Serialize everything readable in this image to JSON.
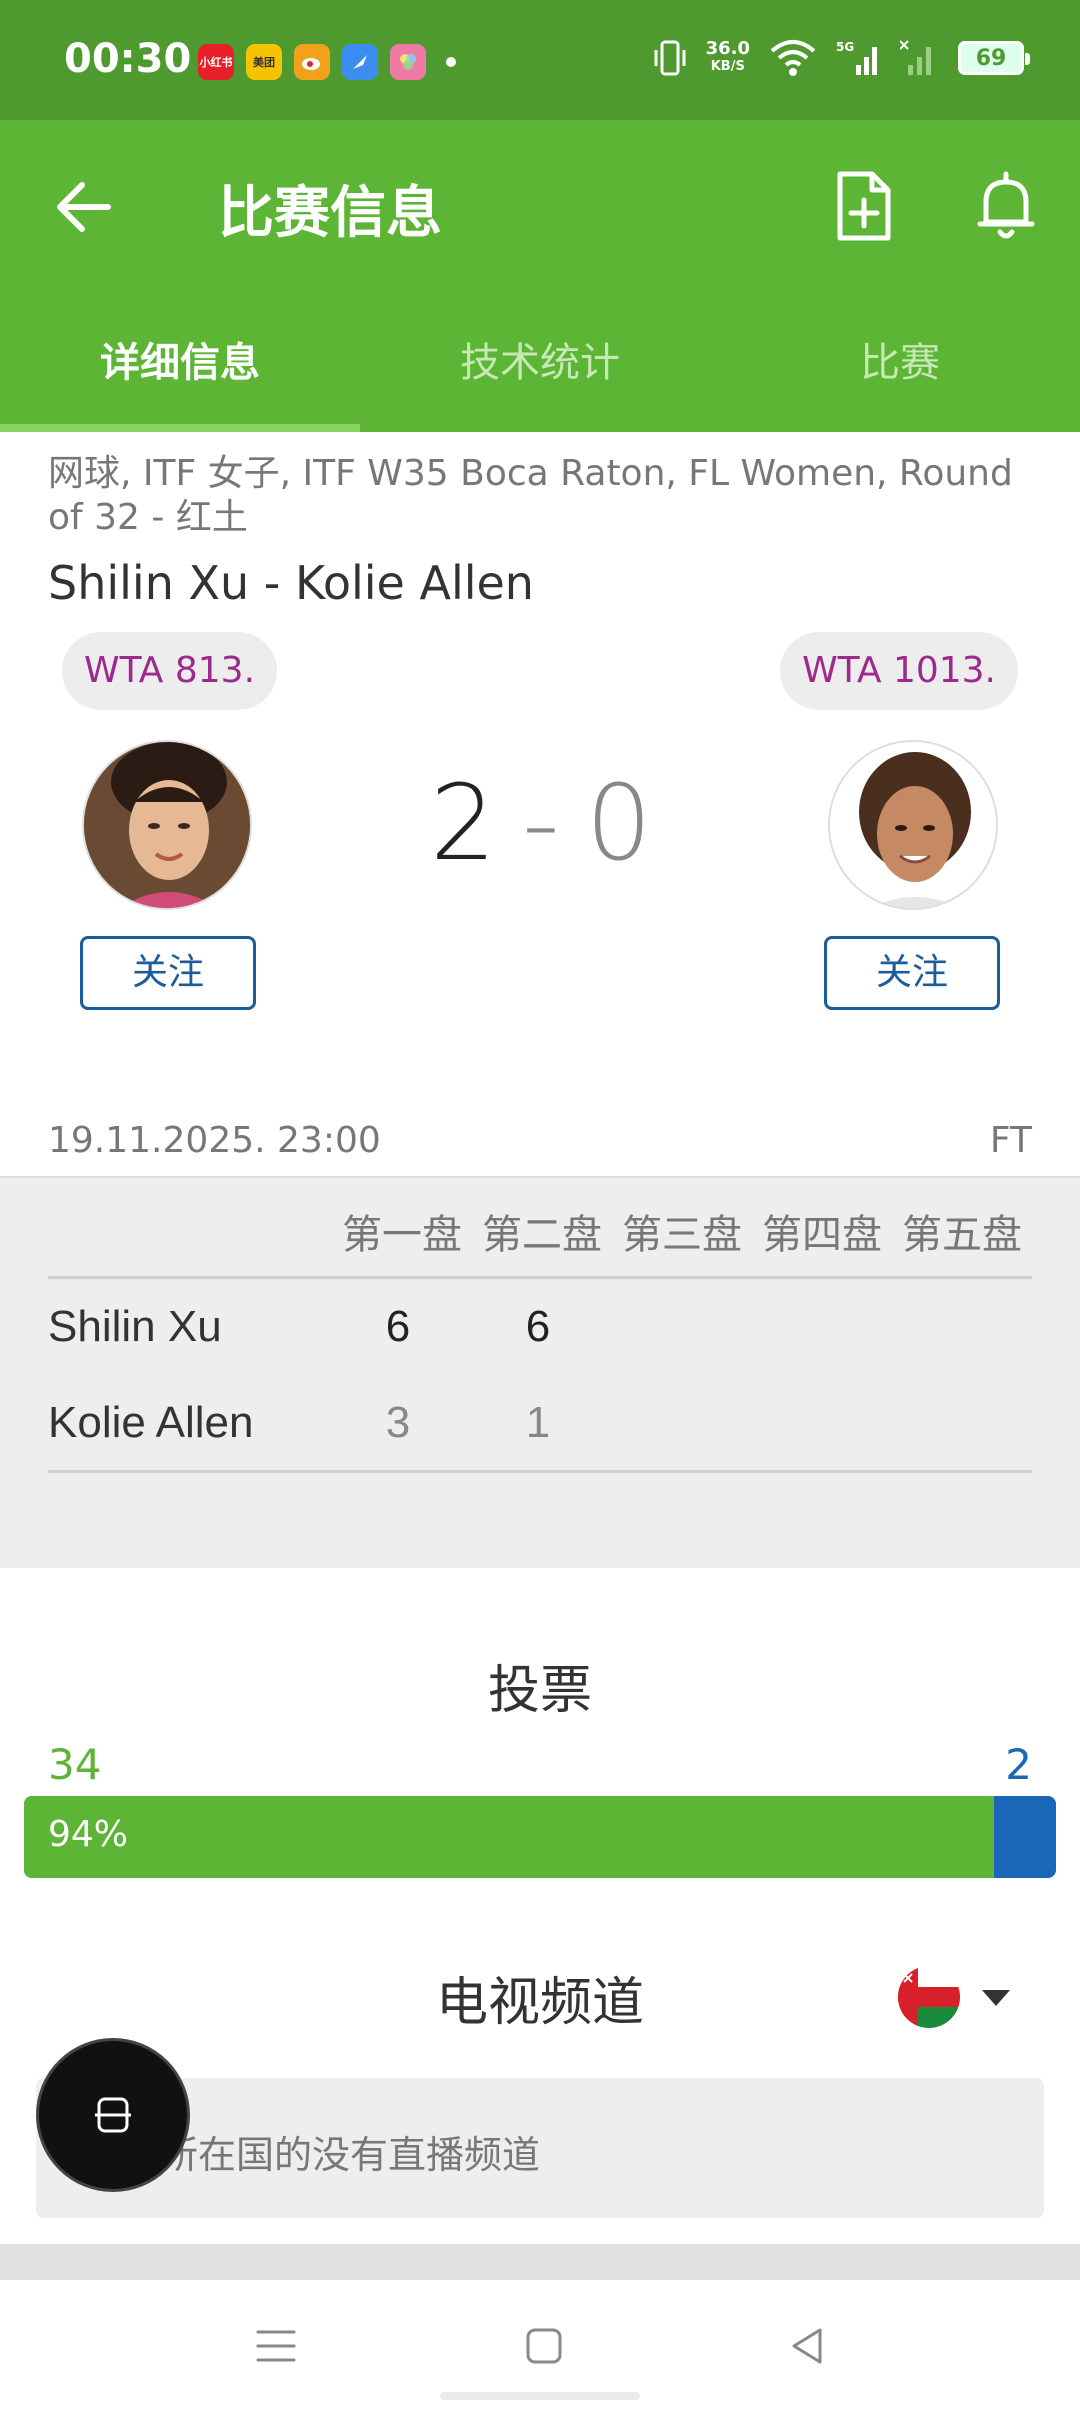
{
  "status_bar": {
    "time": "00:30",
    "apps": [
      {
        "name": "xiaohongshu-icon",
        "label": "小红书",
        "color": "#e8202a"
      },
      {
        "name": "meituan-icon",
        "label": "美团",
        "color": "#f5c400"
      },
      {
        "name": "weibo-icon",
        "label": "",
        "color": "#f2a11c"
      },
      {
        "name": "browser-icon",
        "label": "",
        "color": "#3b8df0"
      },
      {
        "name": "photos-icon",
        "label": "",
        "color": "#f07aa6"
      }
    ],
    "net_speed_value": "36.0",
    "net_speed_unit": "KB/S",
    "battery": "69"
  },
  "app_bar": {
    "title": "比赛信息"
  },
  "tabs": [
    {
      "label": "详细信息",
      "active": true
    },
    {
      "label": "技术统计",
      "active": false
    },
    {
      "label": "比赛",
      "active": false
    }
  ],
  "match": {
    "tournament": "网球, ITF 女子, ITF W35 Boca Raton, FL Women, Round of 32 - 红土",
    "title": "Shilin Xu - Kolie Allen",
    "home_rank": "WTA 813.",
    "away_rank": "WTA 1013.",
    "home_sets": "2",
    "separator": "-",
    "away_sets": "0",
    "follow_label": "关注",
    "datetime": "19.11.2025. 23:00",
    "status": "FT"
  },
  "score_table": {
    "set_headers": [
      "第一盘",
      "第二盘",
      "第三盘",
      "第四盘",
      "第五盘"
    ],
    "rows": [
      {
        "player": "Shilin Xu",
        "sets": [
          "6",
          "6"
        ]
      },
      {
        "player": "Kolie Allen",
        "sets": [
          "3",
          "1"
        ]
      }
    ]
  },
  "vote": {
    "title": "投票",
    "home_votes": "34",
    "away_votes": "2",
    "home_percent_label": "94%",
    "home_share": 0.94,
    "home_color": "#5db535",
    "away_color": "#1a67b8"
  },
  "tv": {
    "title": "电视频道",
    "message": "在您所在国的没有直播频道",
    "flag": "oman-flag"
  },
  "colors": {
    "primary": "#5db535",
    "status_bar": "#4e9a2e",
    "follow_blue": "#1a5d9a",
    "rank_purple": "#9b2a8b"
  }
}
